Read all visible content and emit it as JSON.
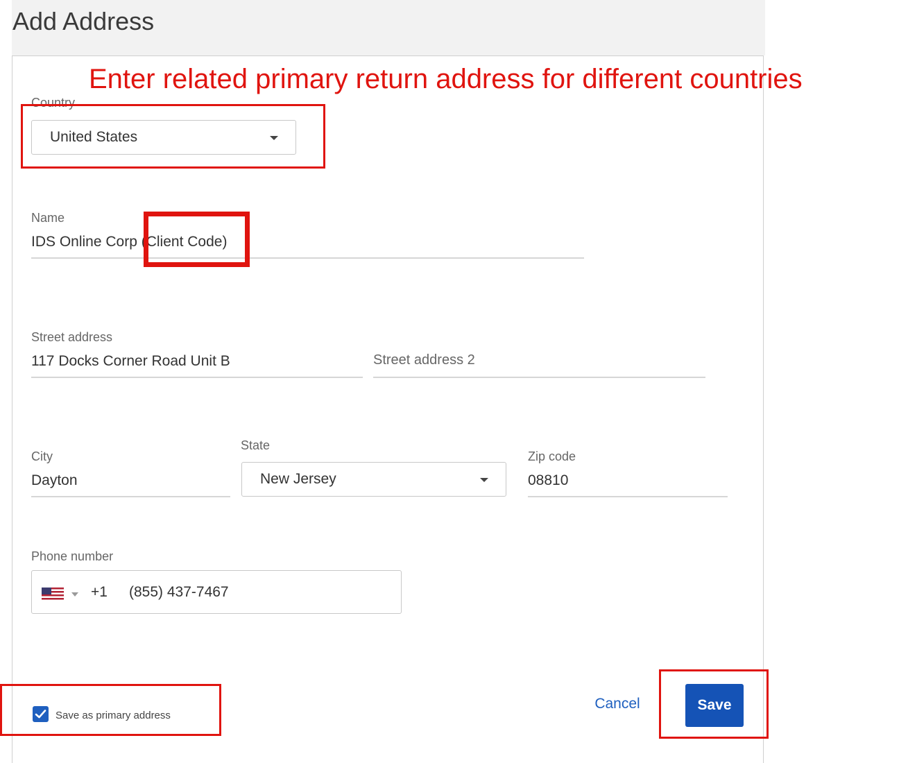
{
  "page": {
    "title": "Add Address"
  },
  "annotation": {
    "text": "Enter related primary return address for different countries",
    "color": "#e0140f"
  },
  "country": {
    "label": "Country",
    "value": "United States"
  },
  "name": {
    "label": "Name",
    "value": "IDS Online Corp (Client Code)"
  },
  "street": {
    "label": "Street address",
    "value": "117 Docks Corner Road Unit B",
    "label2": "Street address 2"
  },
  "city": {
    "label": "City",
    "value": "Dayton"
  },
  "state": {
    "label": "State",
    "value": "New Jersey"
  },
  "zip": {
    "label": "Zip code",
    "value": "08810"
  },
  "phone": {
    "label": "Phone number",
    "flag_icon": "us-flag-icon",
    "dial_code": "+1",
    "number": "(855) 437-7467"
  },
  "primary": {
    "label": "Save as primary address",
    "checked": true
  },
  "actions": {
    "cancel_label": "Cancel",
    "save_label": "Save",
    "accent": "#1553b6"
  }
}
